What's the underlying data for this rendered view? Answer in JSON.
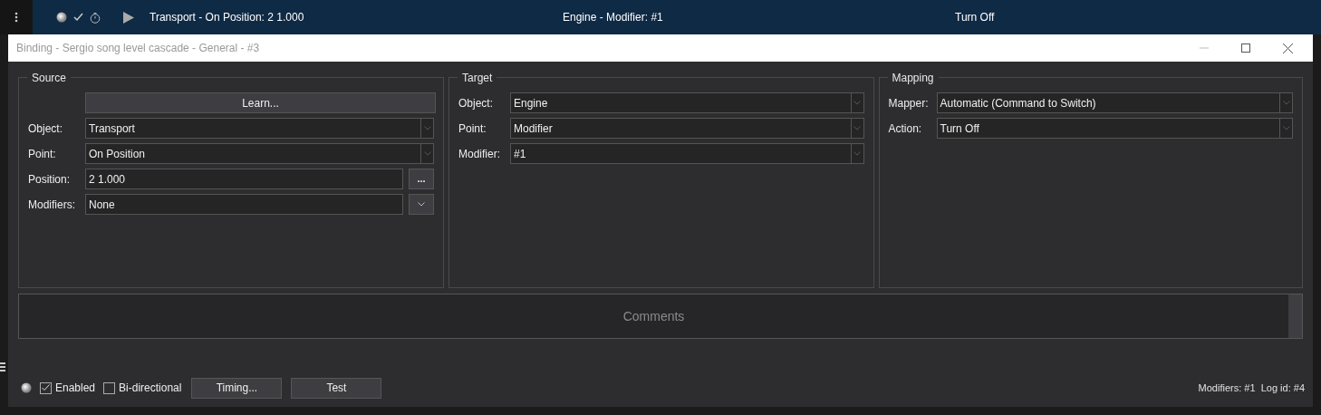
{
  "list_row": {
    "selected": true,
    "columns": [
      "Transport - On Position: 2 1.000",
      "Engine - Modifier: #1",
      "Turn Off"
    ]
  },
  "window": {
    "title": "Binding - Sergio song level cascade - General - #3"
  },
  "source": {
    "title": "Source",
    "learn_button": "Learn...",
    "rows": [
      {
        "kind": "combo",
        "label": "Object:",
        "value": "Transport"
      },
      {
        "kind": "combo",
        "label": "Point:",
        "value": "On Position"
      },
      {
        "kind": "field_button",
        "label": "Position:",
        "value": "2 1.000",
        "button": "..."
      },
      {
        "kind": "field_menu",
        "label": "Modifiers:",
        "value": "None"
      }
    ]
  },
  "target": {
    "title": "Target",
    "rows": [
      {
        "kind": "combo",
        "label": "Object:",
        "value": "Engine"
      },
      {
        "kind": "combo",
        "label": "Point:",
        "value": "Modifier"
      },
      {
        "kind": "combo",
        "label": "Modifier:",
        "value": "#1"
      }
    ]
  },
  "mapping": {
    "title": "Mapping",
    "rows": [
      {
        "kind": "combo",
        "label": "Mapper:",
        "value": "Automatic (Command to Switch)"
      },
      {
        "kind": "combo",
        "label": "Action:",
        "value": "Turn Off"
      }
    ]
  },
  "comments": {
    "placeholder": "Comments"
  },
  "footer": {
    "enabled": {
      "label": "Enabled",
      "checked": true
    },
    "bidirectional": {
      "label": "Bi-directional",
      "checked": false
    },
    "buttons": [
      "Timing...",
      "Test"
    ],
    "status": "Modifiers: #1  Log id: #4"
  }
}
